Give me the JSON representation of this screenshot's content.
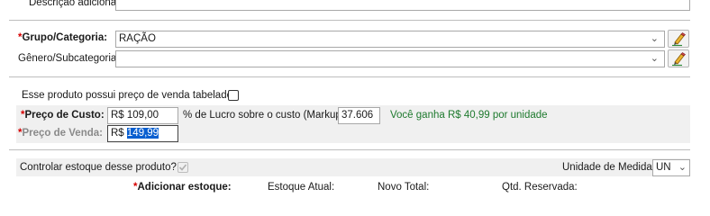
{
  "descricao": {
    "label": "Descrição adicional:",
    "value": ""
  },
  "grupo": {
    "label": "Grupo/Categoria:",
    "required_mark": "*",
    "value": "RAÇÃO"
  },
  "genero": {
    "label": "Gênero/Subcategoria:",
    "value": ""
  },
  "preco_tabelado": {
    "label": "Esse produto possui preço de venda tabelado?",
    "checked": false
  },
  "custo": {
    "label": "Preço de Custo:",
    "required_mark": "*",
    "value": "R$ 109,00"
  },
  "markup": {
    "label": "% de Lucro sobre o custo (Markup):",
    "value": "37.606"
  },
  "ganho_text": "Você ganha R$ 40,99 por unidade",
  "venda": {
    "label": "Preço de Venda:",
    "required_mark": "*",
    "prefix": "R$ ",
    "selected_value": "149,99"
  },
  "estoque": {
    "label": "Controlar estoque desse produto?",
    "checked": true
  },
  "unidade": {
    "label": "Unidade de Medida:",
    "value": "UN"
  },
  "estoque_row": {
    "adicionar_label": "Adicionar estoque:",
    "required_mark": "*",
    "atual_label": "Estoque Atual:",
    "novo_label": "Novo Total:",
    "reservada_label": "Qtd. Reservada:"
  },
  "icons": {
    "edit": "pencil-edit-icon",
    "dropdown": "chevron-down-icon",
    "check": "check-icon"
  },
  "colors": {
    "required": "#d60000",
    "ganho": "#1e7a2e",
    "selection": "#0a5fd0",
    "disabled_band": "#f0f0f0"
  }
}
